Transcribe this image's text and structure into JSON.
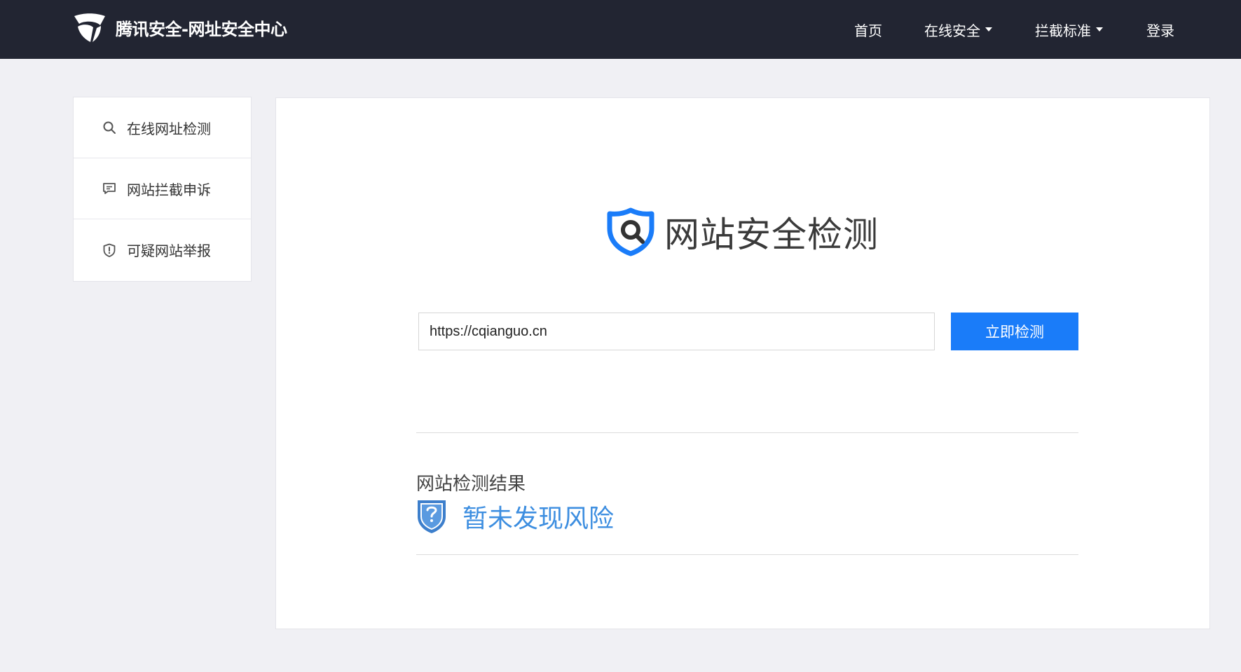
{
  "header": {
    "brand_title": "腾讯安全-网址安全中心",
    "nav": [
      {
        "label": "首页",
        "dropdown": false
      },
      {
        "label": "在线安全",
        "dropdown": true
      },
      {
        "label": "拦截标准",
        "dropdown": true
      },
      {
        "label": "登录",
        "dropdown": false
      }
    ]
  },
  "sidebar": {
    "items": [
      {
        "label": "在线网址检测",
        "icon": "search-icon"
      },
      {
        "label": "网站拦截申诉",
        "icon": "message-icon"
      },
      {
        "label": "可疑网站举报",
        "icon": "shield-alert-icon"
      }
    ]
  },
  "main": {
    "title": "网站安全检测",
    "url_input": {
      "value": "https://cqianguo.cn",
      "placeholder": ""
    },
    "check_button": "立即检测",
    "result_title": "网站检测结果",
    "result_status": "暂未发现风险"
  },
  "colors": {
    "header_bg": "#222532",
    "accent": "#1a7cf9",
    "result_text": "#3d8ee0",
    "page_bg": "#f0f0f4"
  }
}
